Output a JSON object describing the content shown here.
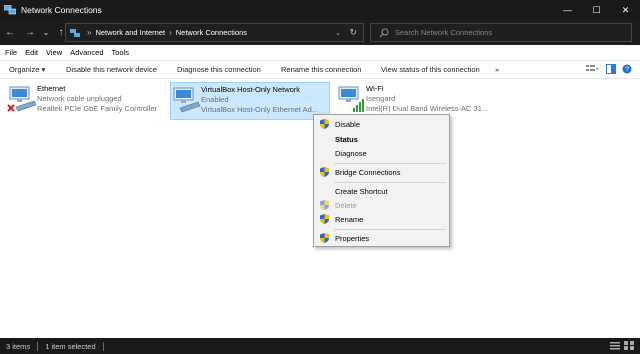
{
  "window": {
    "title": "Network Connections",
    "minimize_glyph": "—",
    "maximize_glyph": "☐",
    "close_glyph": "✕"
  },
  "nav": {
    "back_glyph": "←",
    "forward_glyph": "→",
    "dropdown_glyph": "⌄",
    "up_glyph": "↑"
  },
  "address": {
    "crumbs": [
      "Network and Internet",
      "Network Connections"
    ],
    "separator": "›",
    "first_separator": "»",
    "dropdown_glyph": "⌄",
    "refresh_glyph": "↻"
  },
  "search": {
    "placeholder": "Search Network Connections"
  },
  "menu": {
    "items": [
      "File",
      "Edit",
      "View",
      "Advanced",
      "Tools"
    ]
  },
  "commands": {
    "organize": "Organize ▾",
    "disable": "Disable this network device",
    "diagnose": "Diagnose this connection",
    "rename": "Rename this connection",
    "view_status": "View status of this connection",
    "more": "»"
  },
  "connections": [
    {
      "name": "Ethernet",
      "status": "Network cable unplugged",
      "device": "Realtek PCIe GbE Family Controller",
      "icon": "ethernet-disconnected-icon"
    },
    {
      "name": "VirtualBox Host-Only Network",
      "status": "Enabled",
      "device": "VirtualBox Host-Only Ethernet Ad...",
      "icon": "ethernet-adapter-icon",
      "selected": true
    },
    {
      "name": "Wi-Fi",
      "status": "Isengard",
      "device": "Intel(R) Dual Band Wireless-AC 31...",
      "icon": "wifi-adapter-icon"
    }
  ],
  "context_menu": {
    "items": [
      {
        "label": "Disable",
        "shield": true,
        "state": "normal"
      },
      {
        "label": "Status",
        "shield": false,
        "state": "bold"
      },
      {
        "label": "Diagnose",
        "shield": false,
        "state": "normal"
      },
      {
        "label": "Bridge Connections",
        "shield": true,
        "state": "normal"
      },
      {
        "label": "Create Shortcut",
        "shield": false,
        "state": "normal"
      },
      {
        "label": "Delete",
        "shield": true,
        "state": "disabled"
      },
      {
        "label": "Rename",
        "shield": true,
        "state": "normal"
      },
      {
        "label": "Properties",
        "shield": true,
        "state": "normal"
      }
    ]
  },
  "status": {
    "count": "3 items",
    "selected": "1 item selected"
  },
  "colors": {
    "selection_bg": "#cce8ff",
    "selection_border": "#99d1ff",
    "titlebar_bg": "#1a1a1a",
    "accent": "#0078d7"
  }
}
